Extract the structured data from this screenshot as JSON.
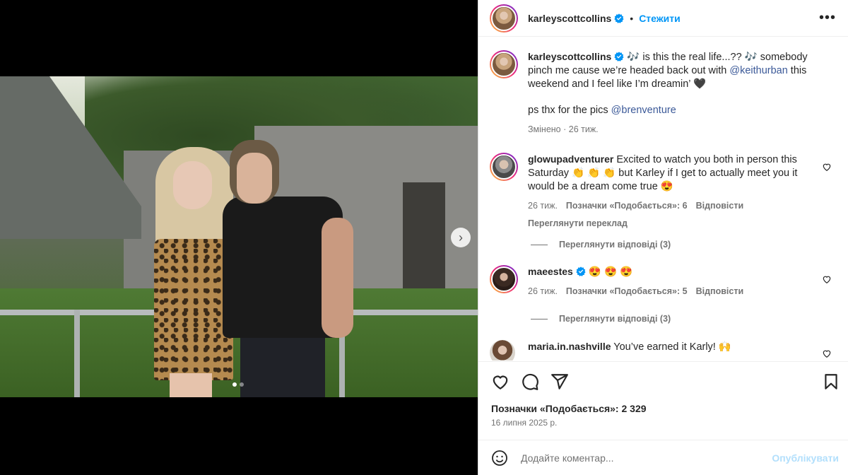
{
  "post": {
    "author": "karleyscottcollins",
    "follow_label": "Стежити",
    "more_label": "•••",
    "caption": {
      "emoji_1": "🎶",
      "part_1": " is this the real life...?? ",
      "emoji_2": "🎶",
      "part_2": " somebody pinch me cause we’re headed back out with ",
      "mention_1": "@keithurban",
      "part_3": " this weekend and I feel like I’m dreamin’ 🖤",
      "ps_text": "ps thx for the pics ",
      "mention_2": "@brenventure",
      "edited": "Змінено · 26 тиж."
    },
    "carousel": {
      "next_icon": "›",
      "slide_count": 2,
      "active_slide": 1
    }
  },
  "comments": [
    {
      "username": "glowupadventurer",
      "text": "Excited to watch you both in person this Saturday 👏 👏 👏 but Karley if I get to actually meet you it would be a dream come true 😍",
      "time": "26 тиж.",
      "likes": "Позначки «Подобається»: 6",
      "reply": "Відповісти",
      "translate": "Переглянути переклад",
      "view_replies": "Переглянути відповіді (3)"
    },
    {
      "username": "maeestes",
      "text": "😍 😍 😍",
      "time": "26 тиж.",
      "likes": "Позначки «Подобається»: 5",
      "reply": "Відповісти",
      "view_replies": "Переглянути відповіді (3)"
    },
    {
      "username": "maria.in.nashville",
      "text": "You’ve earned it Karly! 🙌"
    }
  ],
  "footer": {
    "likes": "Позначки «Подобається»: 2 329",
    "date": "16 липня 2025 р.",
    "comment_placeholder": "Додайте коментар...",
    "publish_label": "Опублікувати"
  },
  "colors": {
    "accent": "#0095f6",
    "publish_disabled": "#b2dffc",
    "verified": "#0095f6"
  }
}
